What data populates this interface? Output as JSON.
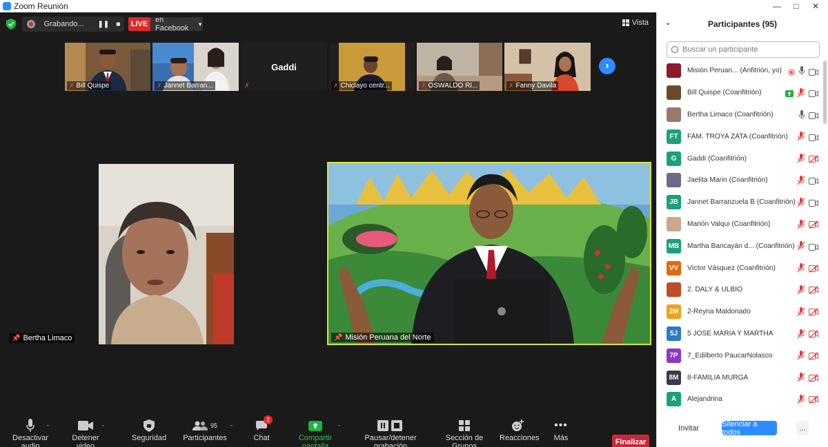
{
  "window": {
    "title": "Zoom Reunión"
  },
  "topbar": {
    "recording_label": "Grabando...",
    "live_label": "LIVE",
    "live_target": "en Facebook",
    "view_label": "Vista"
  },
  "thumbnails": [
    {
      "name": "Bill Quispe",
      "kind": "video",
      "bg": "#7a5a3c"
    },
    {
      "name": "Jannet Barran...",
      "kind": "video",
      "bg": "#3a6fb0"
    },
    {
      "name": "Gaddi",
      "kind": "text",
      "bg": "#1f1f1f"
    },
    {
      "name": "Chiclayo centr...",
      "kind": "video",
      "bg": "#c99a3a"
    },
    {
      "name": "OSWALDO RI...",
      "kind": "video",
      "bg": "#a88b6e"
    },
    {
      "name": "Fanny Davila",
      "kind": "video",
      "bg": "#d4c2a8"
    }
  ],
  "main_tiles": [
    {
      "name": "Bertha Limaco"
    },
    {
      "name": "Misión Peruana del Norte"
    }
  ],
  "toolbar": {
    "mic": "Desactivar audio",
    "video": "Detener video",
    "security": "Seguridad",
    "participants": "Participantes",
    "participants_count": "95",
    "chat": "Chat",
    "chat_badge": "2",
    "share": "Compartir pantalla",
    "record": "Pausar/detener grabación",
    "breakout": "Sección de Grupos",
    "reactions": "Reacciones",
    "more": "Más",
    "end": "Finalizar"
  },
  "participants_panel": {
    "title": "Participantes (95)",
    "search_placeholder": "Buscar un participante",
    "invite_label": "Invitar",
    "mute_all_label": "Silenciar a todos",
    "more_label": "...",
    "items": [
      {
        "name": "Misión Peruan...  (Anfitrión, yo)",
        "initials": "",
        "color": "#8b1a2b",
        "mic": "on-rec",
        "video": "on"
      },
      {
        "name": "Bill Quispe (Coanfitrión)",
        "initials": "",
        "color": "#6b4a2a",
        "mic": "muted",
        "video": "on",
        "share": true
      },
      {
        "name": "Bertha Limaco (Coanfitrión)",
        "initials": "",
        "color": "#9a7a6a",
        "mic": "on",
        "video": "on"
      },
      {
        "name": "FAM. TROYA ZATA (Coanfitrión)",
        "initials": "FT",
        "color": "#1aa07a",
        "mic": "muted",
        "video": "on"
      },
      {
        "name": "Gaddi (Coanfitrión)",
        "initials": "G",
        "color": "#1aa07a",
        "mic": "muted",
        "video": "off"
      },
      {
        "name": "Jaelita Marin (Coanfitrión)",
        "initials": "",
        "color": "#6a6a8a",
        "mic": "muted",
        "video": "on"
      },
      {
        "name": "Jannet Barranzuela B (Coanfitrión)",
        "initials": "JB",
        "color": "#1aa07a",
        "mic": "muted",
        "video": "on"
      },
      {
        "name": "Marión Valqui (Coanfitrión)",
        "initials": "",
        "color": "#c9a98a",
        "mic": "muted",
        "video": "off"
      },
      {
        "name": "Martha Bancayàn d...   (Coanfitrión)",
        "initials": "MB",
        "color": "#1aa07a",
        "mic": "muted",
        "video": "on"
      },
      {
        "name": "Víctor Vásquez (Coanfitrión)",
        "initials": "VV",
        "color": "#e06a10",
        "mic": "muted",
        "video": "off"
      },
      {
        "name": "2. DALY & ULBIO",
        "initials": "",
        "color": "#c04a2a",
        "mic": "muted",
        "video": "off"
      },
      {
        "name": "2-Reyna Maldonado",
        "initials": "2M",
        "color": "#f0a020",
        "mic": "muted",
        "video": "off"
      },
      {
        "name": "5 JOSÉ MARIA Y MARTHA",
        "initials": "5J",
        "color": "#2a7ac9",
        "mic": "muted",
        "video": "off"
      },
      {
        "name": "7_Edilberto PaucarNolasco",
        "initials": "7P",
        "color": "#8a3ac0",
        "mic": "muted",
        "video": "off"
      },
      {
        "name": "8-FAMILIA MURGA",
        "initials": "8M",
        "color": "#3a3a4a",
        "mic": "muted",
        "video": "off"
      },
      {
        "name": "Alejandrina",
        "initials": "A",
        "color": "#1aa07a",
        "mic": "muted",
        "video": "off"
      }
    ]
  },
  "colors": {
    "accent": "#2d8cff",
    "live": "#e02828",
    "end": "#c8283a",
    "active_speaker": "#d7e53a",
    "share_green": "#1fb141"
  }
}
